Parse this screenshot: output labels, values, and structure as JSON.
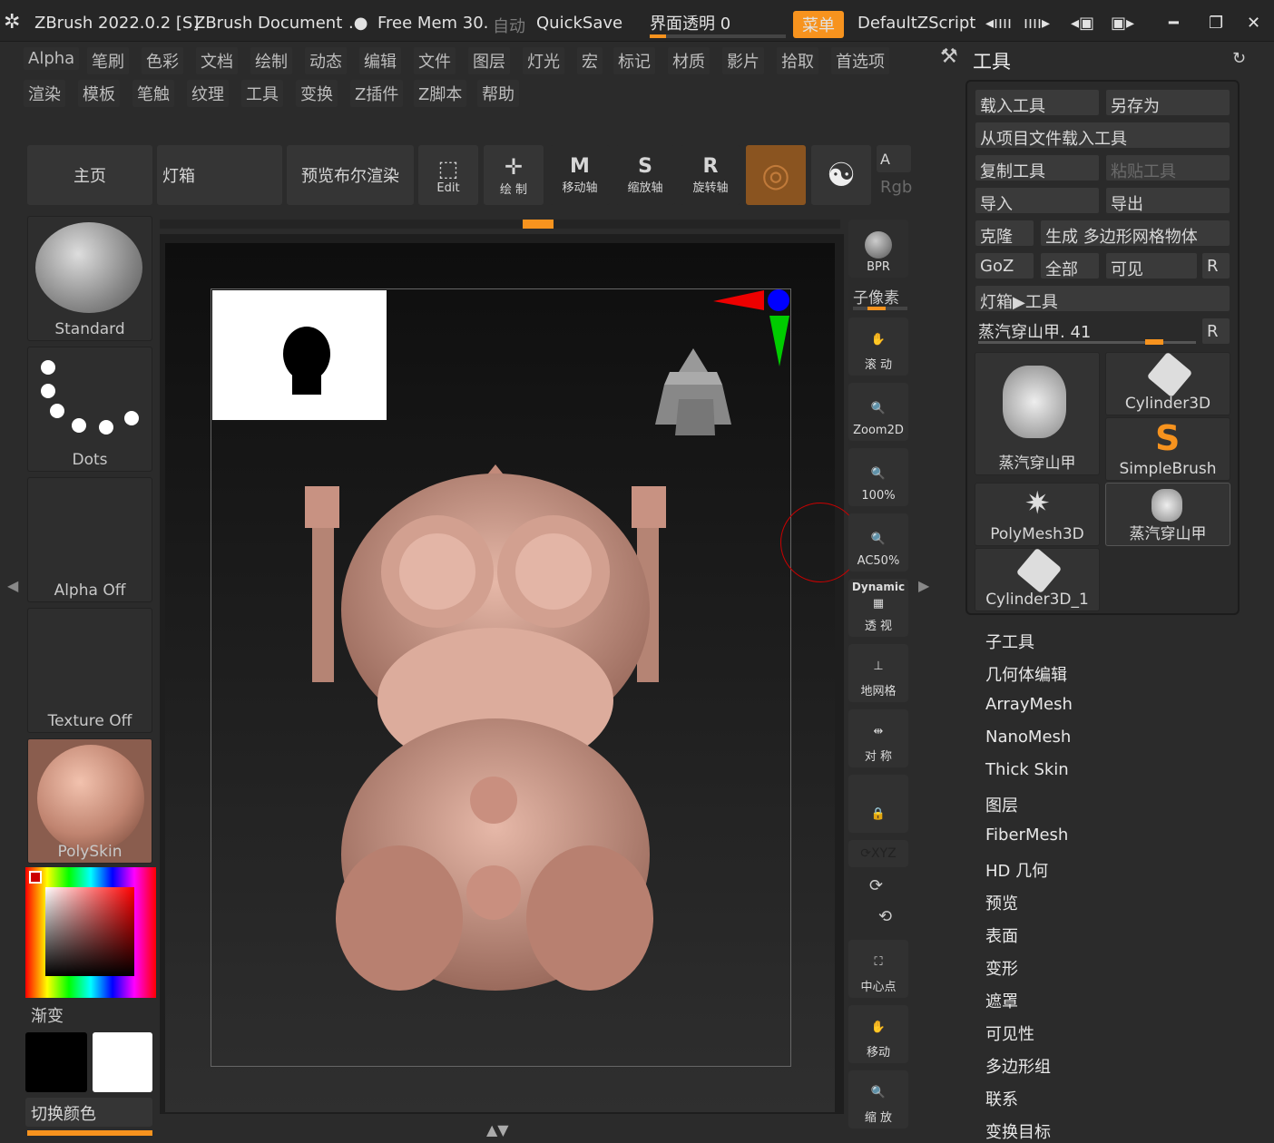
{
  "titlebar": {
    "app": "ZBrush 2022.0.2 [S]",
    "doc": "ZBrush Document",
    "mem": "Free Mem 30.",
    "auto": "自动",
    "quicksave": "QuickSave",
    "transparency": "界面透明 0",
    "menu": "菜单",
    "script": "DefaultZScript"
  },
  "menus": [
    "Alpha",
    "笔刷",
    "色彩",
    "文档",
    "绘制",
    "动态",
    "编辑",
    "文件",
    "图层",
    "灯光",
    "宏",
    "标记",
    "材质",
    "影片",
    "拾取",
    "首选项",
    "渲染",
    "模板",
    "笔触",
    "纹理",
    "工具",
    "变换",
    "Z插件",
    "Z脚本",
    "帮助"
  ],
  "shelf": {
    "home": "主页",
    "lightbox": "灯箱",
    "bpr": "预览布尔渲染",
    "edit": "Edit",
    "draw": "绘 制",
    "move": "移动轴",
    "scale": "缩放轴",
    "rotate": "旋转轴",
    "a": "A",
    "rgb": "Rgb"
  },
  "left": {
    "standard": "Standard",
    "dots": "Dots",
    "alpha": "Alpha Off",
    "texture": "Texture Off",
    "material": "PolySkin",
    "gradient": "渐变",
    "switch": "切换颜色"
  },
  "right": {
    "bpr": "BPR",
    "subpixel": "子像素",
    "scroll": "滚 动",
    "zoom2d": "Zoom2D",
    "p100": "100%",
    "ac50": "AC50%",
    "dynamic": "Dynamic",
    "persp": "透 视",
    "floor": "地网格",
    "sym": "对 称",
    "xyz": "XYZ",
    "center": "中心点",
    "move": "移动",
    "scale": "缩 放"
  },
  "tool": {
    "title": "工具",
    "load": "载入工具",
    "saveas": "另存为",
    "loadproj": "从项目文件载入工具",
    "copy": "复制工具",
    "paste": "粘贴工具",
    "import": "导入",
    "export": "导出",
    "clone": "克隆",
    "makepoly": "生成 多边形网格物体",
    "goz": "GoZ",
    "all": "全部",
    "visible": "可见",
    "r": "R",
    "lightbox": "灯箱▶工具",
    "current": "蒸汽穿山甲. 41",
    "thumbs": [
      "蒸汽穿山甲",
      "Cylinder3D",
      "SimpleBrush",
      "PolyMesh3D",
      "蒸汽穿山甲",
      "Cylinder3D_1"
    ],
    "subpalettes": [
      "子工具",
      "几何体编辑",
      "ArrayMesh",
      "NanoMesh",
      "Thick Skin",
      "图层",
      "FiberMesh",
      "HD 几何",
      "预览",
      "表面",
      "变形",
      "遮罩",
      "可见性",
      "多边形组",
      "联系",
      "变换目标"
    ]
  }
}
